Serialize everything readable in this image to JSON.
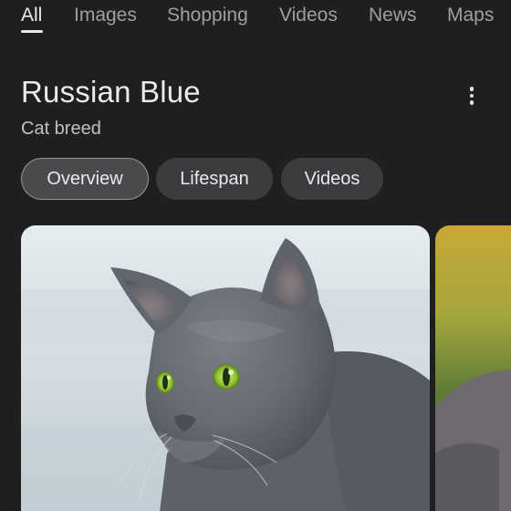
{
  "search_tabs": [
    {
      "label": "All",
      "active": true
    },
    {
      "label": "Images",
      "active": false
    },
    {
      "label": "Shopping",
      "active": false
    },
    {
      "label": "Videos",
      "active": false
    },
    {
      "label": "News",
      "active": false
    },
    {
      "label": "Maps",
      "active": false
    }
  ],
  "entity": {
    "title": "Russian Blue",
    "subtitle": "Cat breed"
  },
  "chips": [
    {
      "label": "Overview",
      "selected": true
    },
    {
      "label": "Lifespan",
      "selected": false
    },
    {
      "label": "Videos",
      "selected": false
    }
  ],
  "images": [
    {
      "subject": "russian-blue-cat-photo",
      "eye_color": "#9bd13c",
      "fur_color": "#6f737c"
    },
    {
      "subject": "second-cat-photo-partial"
    }
  ],
  "icons": {
    "more": "more-vert-icon"
  },
  "colors": {
    "background": "#1f1f1f",
    "chip_background": "#3c3c3e",
    "chip_selected_border": "#8e9196",
    "text_primary": "#e8eaed",
    "text_secondary": "#9aa0a6"
  }
}
